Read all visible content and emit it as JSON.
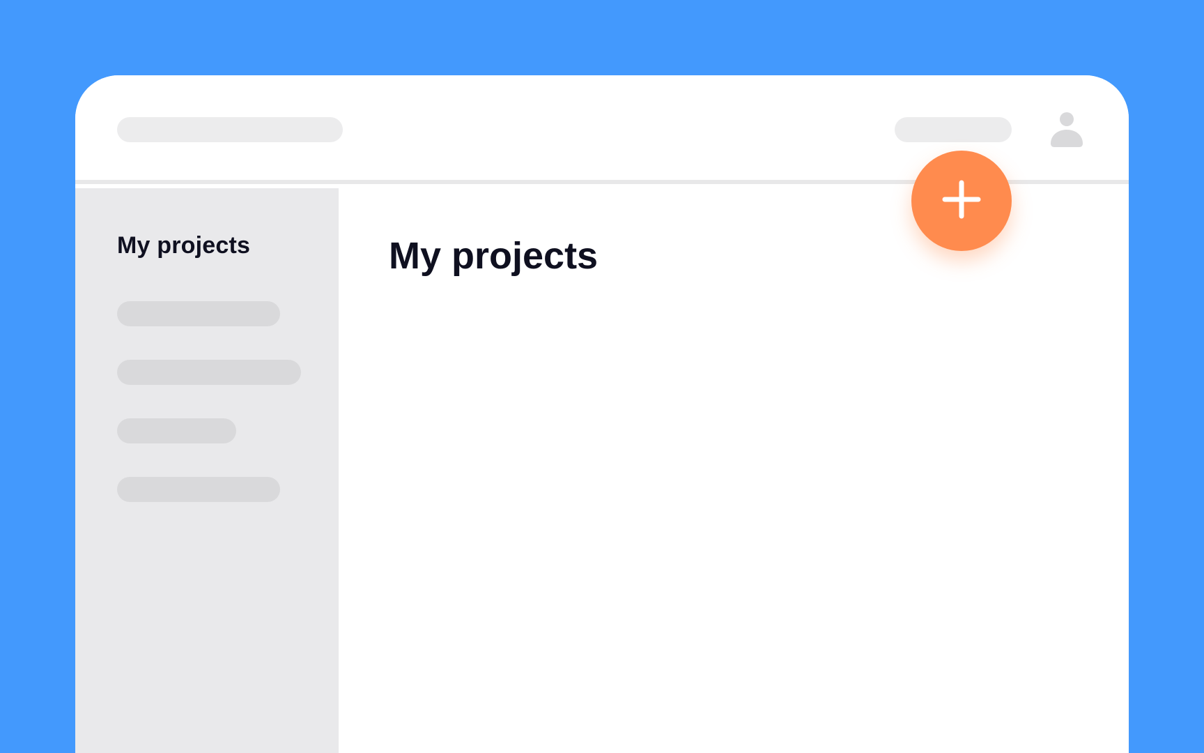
{
  "colors": {
    "background": "#4399fd",
    "window": "#ffffff",
    "sidebar": "#e9e9eb",
    "placeholder": "#d9d9db",
    "accent": "#ff8b4e",
    "text": "#0f1020"
  },
  "topbar": {
    "avatar_icon": "user-avatar-icon"
  },
  "sidebar": {
    "title": "My projects",
    "item_count": 4
  },
  "main": {
    "title": "My projects",
    "add_button_icon": "plus-icon"
  }
}
